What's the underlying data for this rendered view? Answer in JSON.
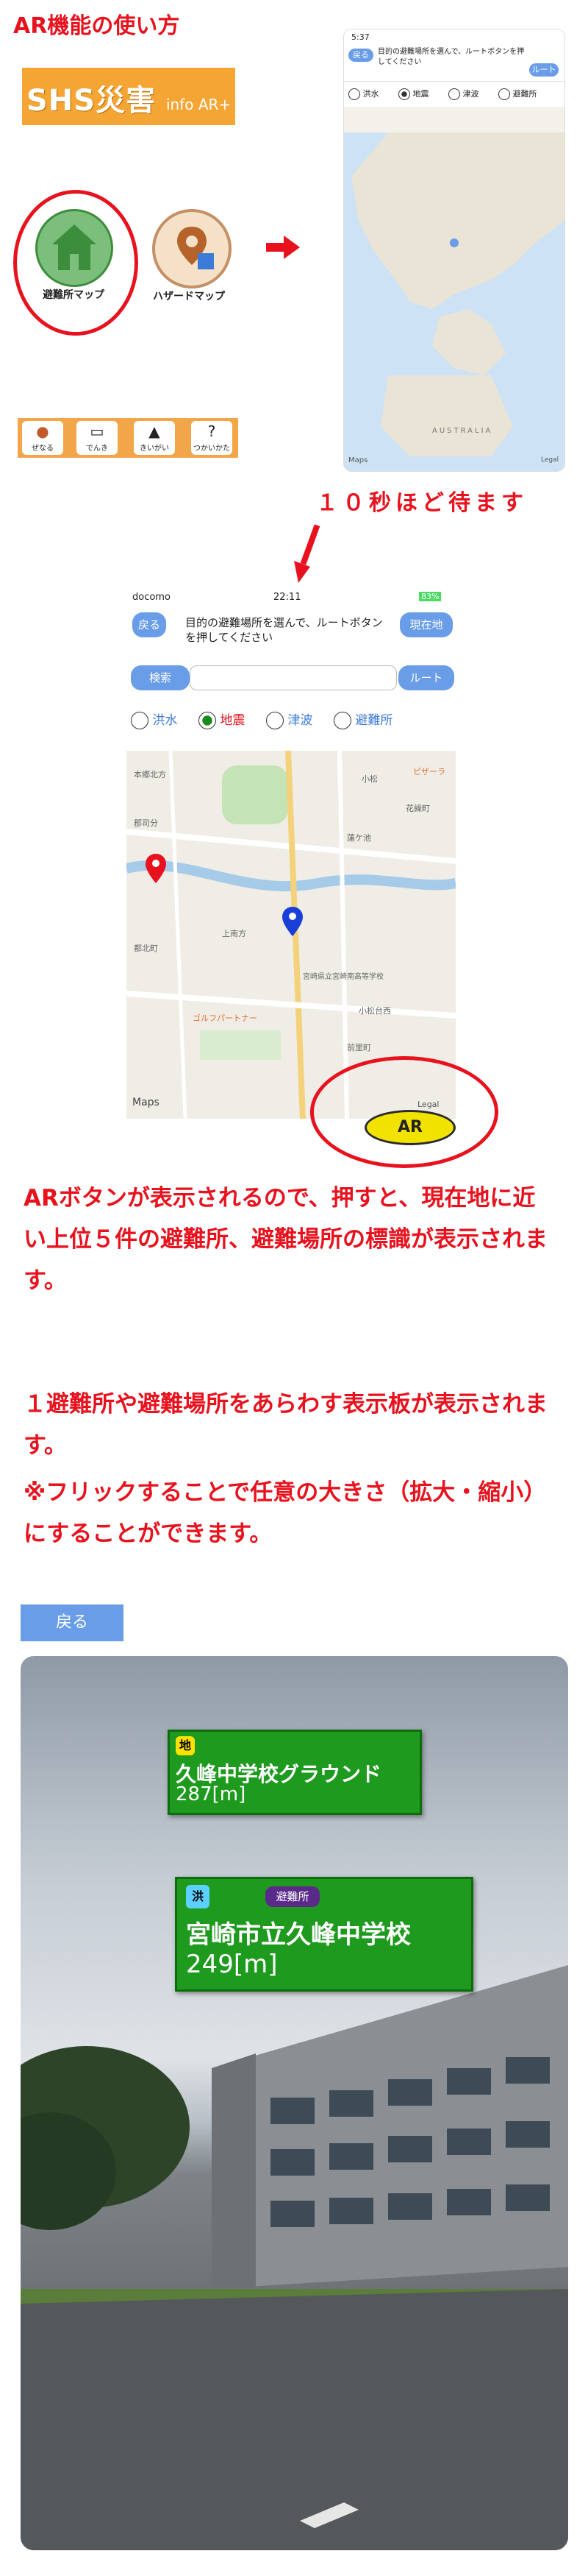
{
  "header": {
    "title": "AR機能の使い方"
  },
  "logo": {
    "main": "SHS災害",
    "sub": "info AR+"
  },
  "home_icons": [
    {
      "label": "避難所マップ"
    },
    {
      "label": "ハザードマップ"
    }
  ],
  "tab_icons": [
    {
      "label": "ぜなる"
    },
    {
      "label": "でんき"
    },
    {
      "label": "きいがい"
    },
    {
      "label": "つかいかた"
    }
  ],
  "phone1": {
    "time": "5:37",
    "back_label": "戻る",
    "instruction": "目的の避難場所を選んで、ルートボタンを押してください",
    "route_label": "ルート",
    "radios": [
      "洪水",
      "地震",
      "津波",
      "避難所"
    ],
    "map_label": "AUSTRALIA",
    "maps_credit": "Maps",
    "legal": "Legal"
  },
  "step_wait": "１０秒ほど待ます",
  "phone2": {
    "carrier": "docomo",
    "time": "22:11",
    "battery": "83%",
    "back_label": "戻る",
    "current_label": "現在地",
    "instruction": "目的の避難場所を選んで、ルートボタンを押してください",
    "search_label": "検索",
    "route_label": "ルート",
    "radios": [
      {
        "label": "洪水",
        "selected": false,
        "color": "#3b7ad8"
      },
      {
        "label": "地震",
        "selected": true,
        "color": "#e8121e"
      },
      {
        "label": "津波",
        "selected": false,
        "color": "#3b7ad8"
      },
      {
        "label": "避難所",
        "selected": false,
        "color": "#3b7ad8"
      }
    ],
    "map_places": [
      "本郷北方",
      "蓮ケ池",
      "小松",
      "ピザーラ",
      "花繰町",
      "郡司分",
      "上南方",
      "都北町",
      "ゴルフパートナー",
      "前里町",
      "宮崎県立宮崎南高等学校",
      "小松台西"
    ],
    "maps_credit": "Maps",
    "legal": "Legal",
    "ar_button": "AR"
  },
  "explain_ar": "ARボタンが表示されるので、押すと、現在地に近い上位５件の避難所、避難場所の標識が表示されます。",
  "explain_signs_1": "１避難所や避難場所をあらわす表示板が表示されます。",
  "explain_signs_2": "※フリックすることで任意の大きさ（拡大・縮小）にすることができます。",
  "ar_screen": {
    "back_label": "戻る",
    "signs": [
      {
        "badges": [
          "地"
        ],
        "name": "久峰中学校グラウンド",
        "distance": "287[m]"
      },
      {
        "badges": [
          "洪",
          "避難所"
        ],
        "name": "宮崎市立久峰中学校",
        "distance": "249[m]"
      }
    ]
  },
  "colors": {
    "accent_red": "#e8121e",
    "button_blue": "#6a9de8",
    "sign_green": "#1e9a1e",
    "logo_orange": "#f5a533"
  }
}
